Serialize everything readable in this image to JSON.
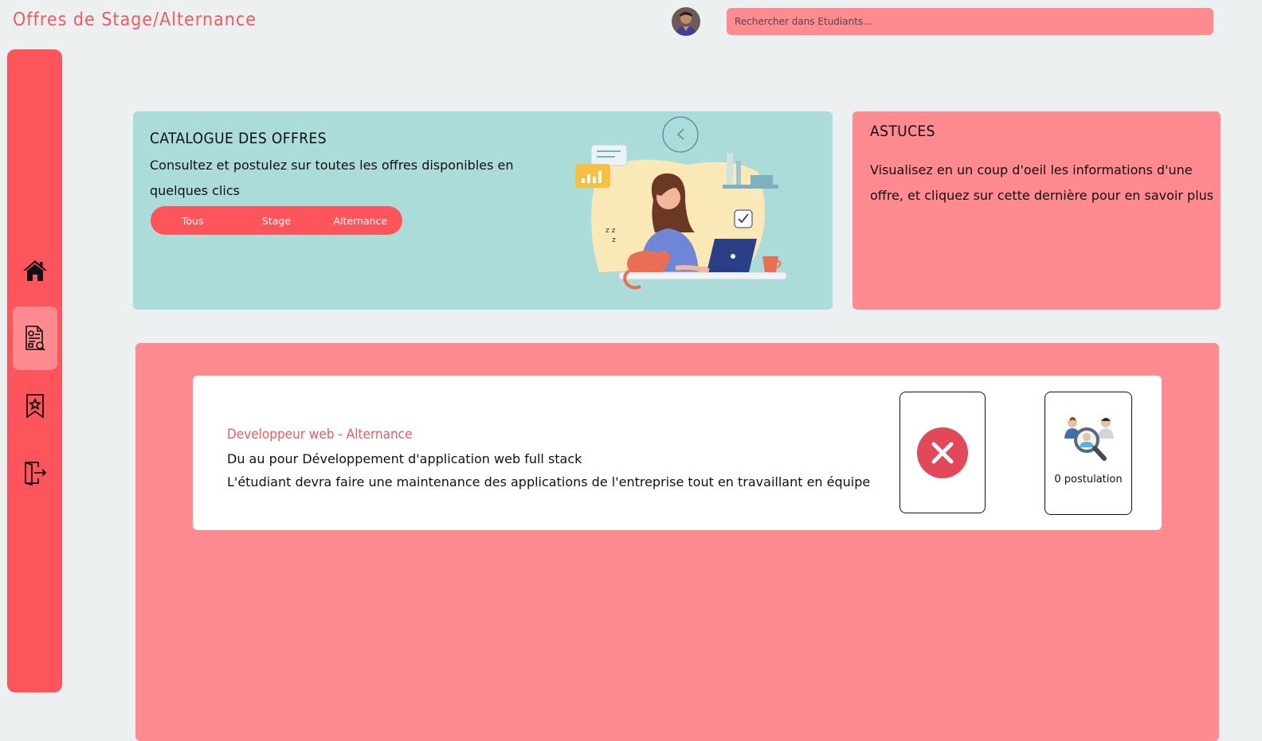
{
  "header": {
    "title": "Offres de Stage/Alternance",
    "search_placeholder": "Rechercher dans Etudiants..."
  },
  "sidebar": {
    "items": [
      {
        "name": "home",
        "icon": "home-icon"
      },
      {
        "name": "offers",
        "icon": "document-icon",
        "active": true
      },
      {
        "name": "favorites",
        "icon": "bookmark-star-icon"
      },
      {
        "name": "logout",
        "icon": "logout-icon"
      }
    ]
  },
  "catalogue": {
    "title": "CATALOGUE DES OFFRES",
    "description": "Consultez et postulez sur toutes les offres disponibles en quelques clics",
    "filters": [
      "Tous",
      "Stage",
      "Alternance"
    ]
  },
  "astuces": {
    "title": "ASTUCES",
    "text": "Visualisez en un coup d'oeil les informations d'une offre, et cliquez sur cette dernière pour en savoir plus"
  },
  "offers": [
    {
      "title": "Developpeur web - Alternance",
      "line1": "Du au pour Développement d'application web full stack",
      "line2": "L'étudiant devra faire une maintenance des applications de l'entreprise tout en travaillant en équipe",
      "postulations": "0 postulation"
    }
  ],
  "colors": {
    "accent": "#fe545c",
    "accent_light": "#ff8a8f",
    "teal_card": "#abdcd9",
    "title_red": "#ee5a62",
    "background": "#ecf0f1"
  }
}
